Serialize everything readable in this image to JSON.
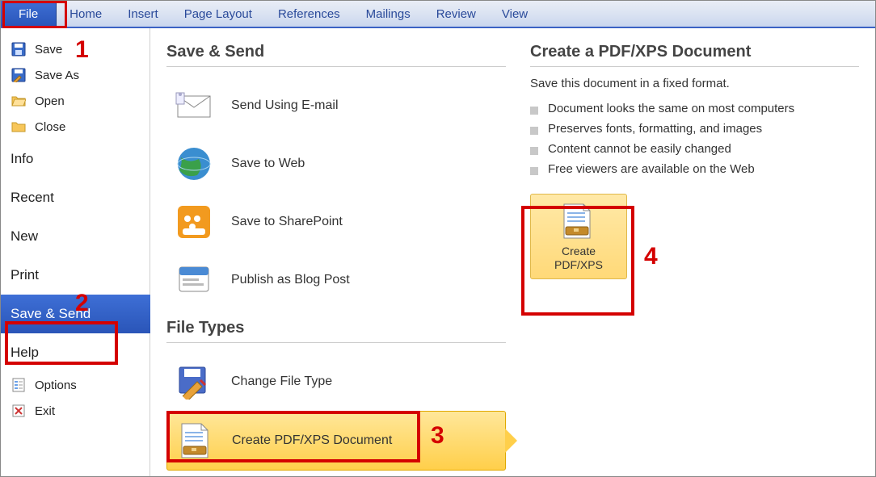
{
  "ribbon": {
    "tabs": [
      "File",
      "Home",
      "Insert",
      "Page Layout",
      "References",
      "Mailings",
      "Review",
      "View"
    ]
  },
  "leftnav": {
    "save": "Save",
    "save_as": "Save As",
    "open": "Open",
    "close": "Close",
    "info": "Info",
    "recent": "Recent",
    "new": "New",
    "print": "Print",
    "save_send": "Save & Send",
    "help": "Help",
    "options": "Options",
    "exit": "Exit"
  },
  "mid": {
    "section1_title": "Save & Send",
    "send_email": "Send Using E-mail",
    "save_web": "Save to Web",
    "save_sharepoint": "Save to SharePoint",
    "publish_blog": "Publish as Blog Post",
    "section2_title": "File Types",
    "change_file_type": "Change File Type",
    "create_pdf_xps": "Create PDF/XPS Document"
  },
  "right": {
    "title": "Create a PDF/XPS Document",
    "desc": "Save this document in a fixed format.",
    "bullets": [
      "Document looks the same on most computers",
      "Preserves fonts, formatting, and images",
      "Content cannot be easily changed",
      "Free viewers are available on the Web"
    ],
    "button_line1": "Create",
    "button_line2": "PDF/XPS"
  },
  "annotations": {
    "n1": "1",
    "n2": "2",
    "n3": "3",
    "n4": "4"
  }
}
